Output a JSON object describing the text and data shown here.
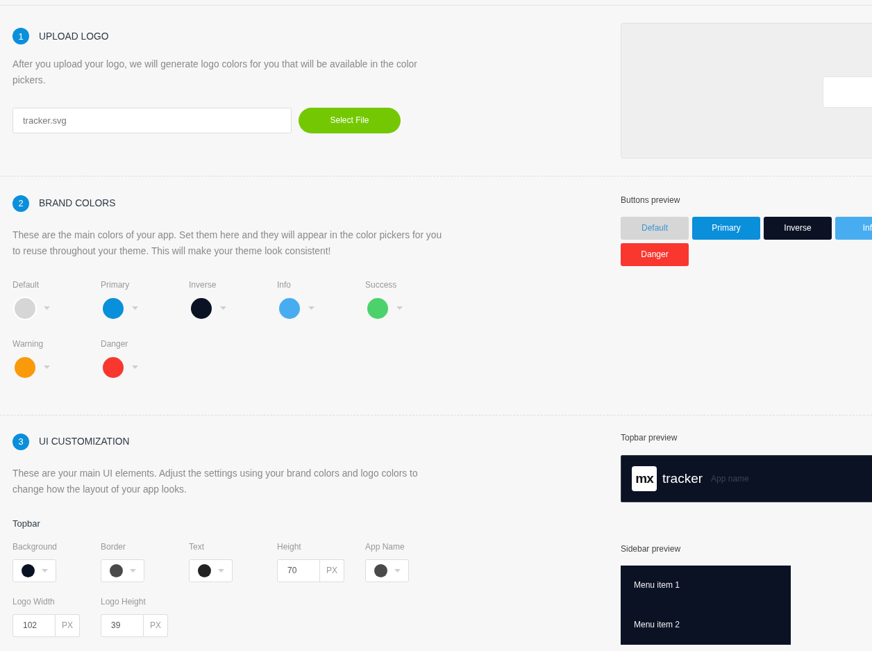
{
  "upload_logo": {
    "step": "1",
    "title": "UPLOAD LOGO",
    "description": "After you upload your logo, we will generate logo colors for you that will be available in the color pickers.",
    "file_field": {
      "value": "tracker.svg"
    },
    "select_button": "Select File"
  },
  "brand_colors": {
    "step": "2",
    "title": "BRAND COLORS",
    "description": "These are the main colors of your app. Set them here and they will appear in the color pickers for you to reuse throughout your theme. This will make your theme look consistent!",
    "colors": [
      {
        "label": "Default",
        "color": "#d6d6d6"
      },
      {
        "label": "Primary",
        "color": "#0a8fdb"
      },
      {
        "label": "Inverse",
        "color": "#0b1224"
      },
      {
        "label": "Info",
        "color": "#48adf0"
      },
      {
        "label": "Success",
        "color": "#4cd26b"
      },
      {
        "label": "Warning",
        "color": "#f99a0a"
      },
      {
        "label": "Danger",
        "color": "#f9372f"
      }
    ],
    "buttons_preview": {
      "label": "Buttons preview",
      "buttons": [
        {
          "label": "Default",
          "kind": "light",
          "color": "#d6d6d6"
        },
        {
          "label": "Primary",
          "kind": "solid",
          "color": "#0a8fdb"
        },
        {
          "label": "Inverse",
          "kind": "solid",
          "color": "#0b1224"
        },
        {
          "label": "Inf",
          "kind": "solid",
          "color": "#48adf0"
        },
        {
          "label": "Danger",
          "kind": "solid",
          "color": "#f9372f"
        }
      ]
    }
  },
  "ui_customization": {
    "step": "3",
    "title": "UI CUSTOMIZATION",
    "description": "These are your main UI elements. Adjust the settings using your brand colors and logo colors to change how the layout of your app looks.",
    "group": "Topbar",
    "settings": [
      {
        "label": "Background",
        "kind": "color",
        "color": "#0b1224"
      },
      {
        "label": "Border",
        "kind": "color",
        "color": "#4a4a4a"
      },
      {
        "label": "Text",
        "kind": "color",
        "color": "#222222"
      },
      {
        "label": "Height",
        "kind": "number",
        "value": "70",
        "unit": "PX"
      },
      {
        "label": "App Name",
        "kind": "color",
        "color": "#4a4a4a"
      },
      {
        "label": "Logo Width",
        "kind": "number",
        "value": "102",
        "unit": "PX"
      },
      {
        "label": "Logo Height",
        "kind": "number",
        "value": "39",
        "unit": "PX"
      }
    ],
    "topbar_preview": {
      "label": "Topbar preview",
      "logo_text": "mx",
      "brand": "tracker",
      "app_name": "App name"
    },
    "sidebar_preview": {
      "label": "Sidebar preview",
      "items": [
        "Menu item 1",
        "Menu item 2"
      ]
    }
  }
}
